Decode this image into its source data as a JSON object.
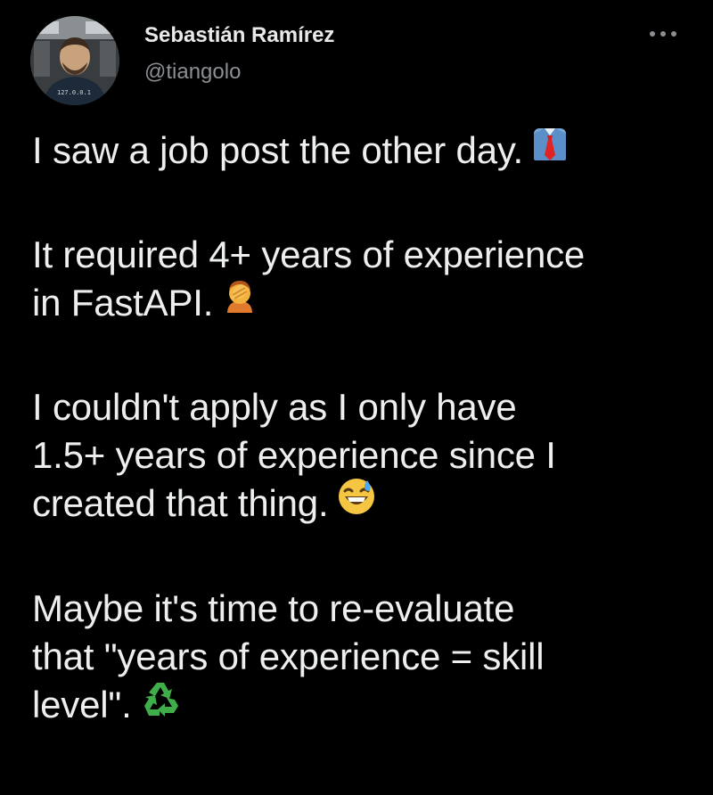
{
  "author": {
    "name": "Sebastián Ramírez",
    "handle": "@tiangolo"
  },
  "icons": {
    "more": "more-horizontal-icon",
    "emoji_1": "necktie-shirt-emoji",
    "emoji_2": "face-palm-emoji",
    "emoji_3": "grinning-sweat-emoji",
    "emoji_4": "recycling-symbol-emoji"
  },
  "tweet": {
    "paragraphs": [
      {
        "lines": [
          "I saw a job post the other day."
        ]
      },
      {
        "lines": [
          "It required 4+ years of experience",
          "in FastAPI."
        ]
      },
      {
        "lines": [
          "I couldn't apply as I only have",
          "1.5+ years of experience since I",
          "created that thing."
        ]
      },
      {
        "lines": [
          "Maybe it's time to re-evaluate",
          "that \"years of experience = skill",
          "level\"."
        ]
      }
    ]
  },
  "colors": {
    "background": "#000000",
    "text": "#e7e9ea",
    "secondary_text": "#8b8f94"
  }
}
